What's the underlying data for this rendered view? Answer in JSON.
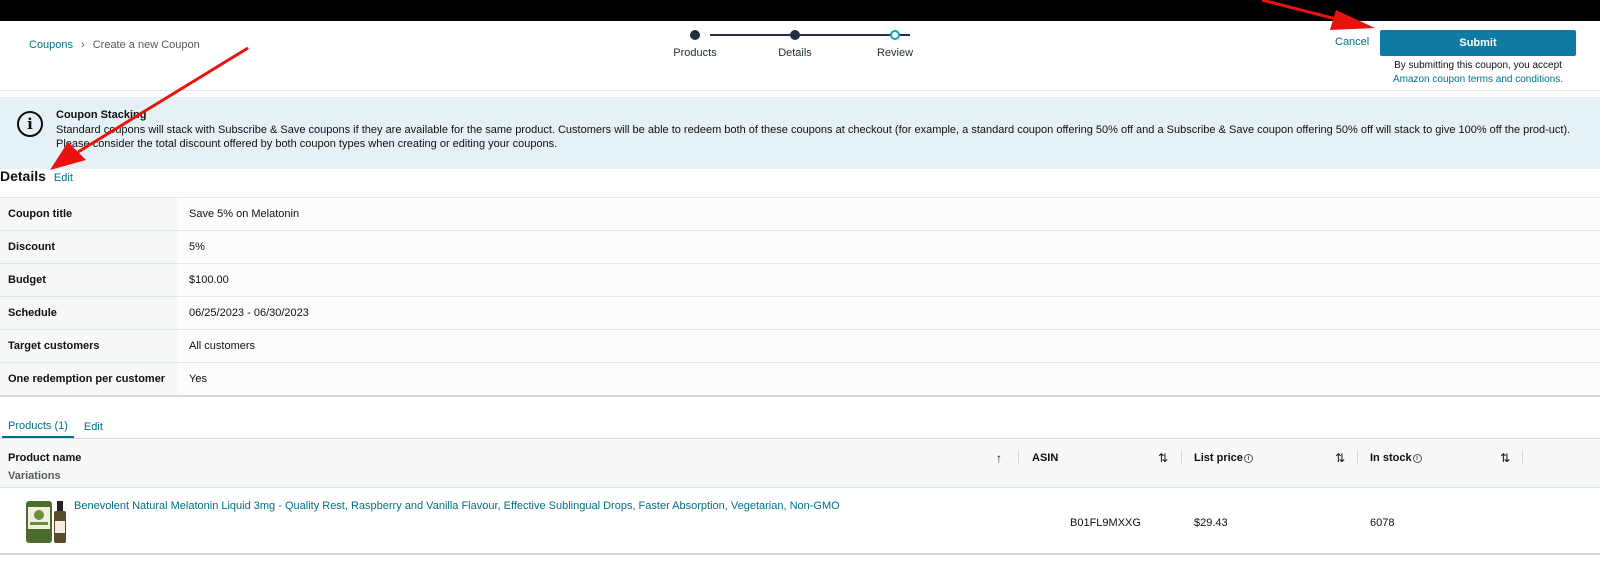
{
  "breadcrumb": {
    "root": "Coupons",
    "current": "Create a new Coupon"
  },
  "stepper": {
    "steps": [
      "Products",
      "Details",
      "Review"
    ]
  },
  "actions": {
    "cancel": "Cancel",
    "submit": "Submit",
    "note_line1": "By submitting this coupon, you accept",
    "note_terms": "Amazon coupon terms and conditions."
  },
  "alert": {
    "title": "Coupon Stacking",
    "text": "Standard coupons will stack with Subscribe & Save coupons if they are available for the same product. Customers will be able to redeem both of these coupons at checkout (for example, a standard coupon offering 50% off and a Subscribe & Save coupon offering 50% off will stack to give 100% off the prod-uct). Please consider the total discount offered by both coupon types when creating or editing your coupons."
  },
  "details": {
    "heading": "Details",
    "edit": "Edit",
    "rows": [
      {
        "label": "Coupon title",
        "value": "Save 5% on Melatonin"
      },
      {
        "label": "Discount",
        "value": "5%"
      },
      {
        "label": "Budget",
        "value": "$100.00"
      },
      {
        "label": "Schedule",
        "value": "06/25/2023 - 06/30/2023"
      },
      {
        "label": "Target customers",
        "value": "All customers"
      },
      {
        "label": "One redemption per customer",
        "value": "Yes"
      }
    ]
  },
  "products": {
    "tab": "Products (1)",
    "edit": "Edit",
    "columns": {
      "name": "Product name",
      "variations": "Variations",
      "asin": "ASIN",
      "list_price": "List price",
      "in_stock": "In stock"
    },
    "items": [
      {
        "name": "Benevolent Natural Melatonin Liquid 3mg - Quality Rest, Raspberry and Vanilla Flavour, Effective Sublingual Drops, Faster Absorption, Vegetarian, Non-GMO",
        "asin": "B01FL9MXXG",
        "list_price": "$29.43",
        "in_stock": "6078"
      }
    ]
  },
  "colors": {
    "accent": "#007185",
    "submit": "#0f7ba4",
    "alert_bg": "#e6f1f5",
    "annotation": "#e8130f"
  },
  "icons": [
    "chevron-right-icon",
    "info-icon",
    "sort-up-icon",
    "sort-both-icon",
    "product-thumbnail",
    "annotation-arrow"
  ]
}
